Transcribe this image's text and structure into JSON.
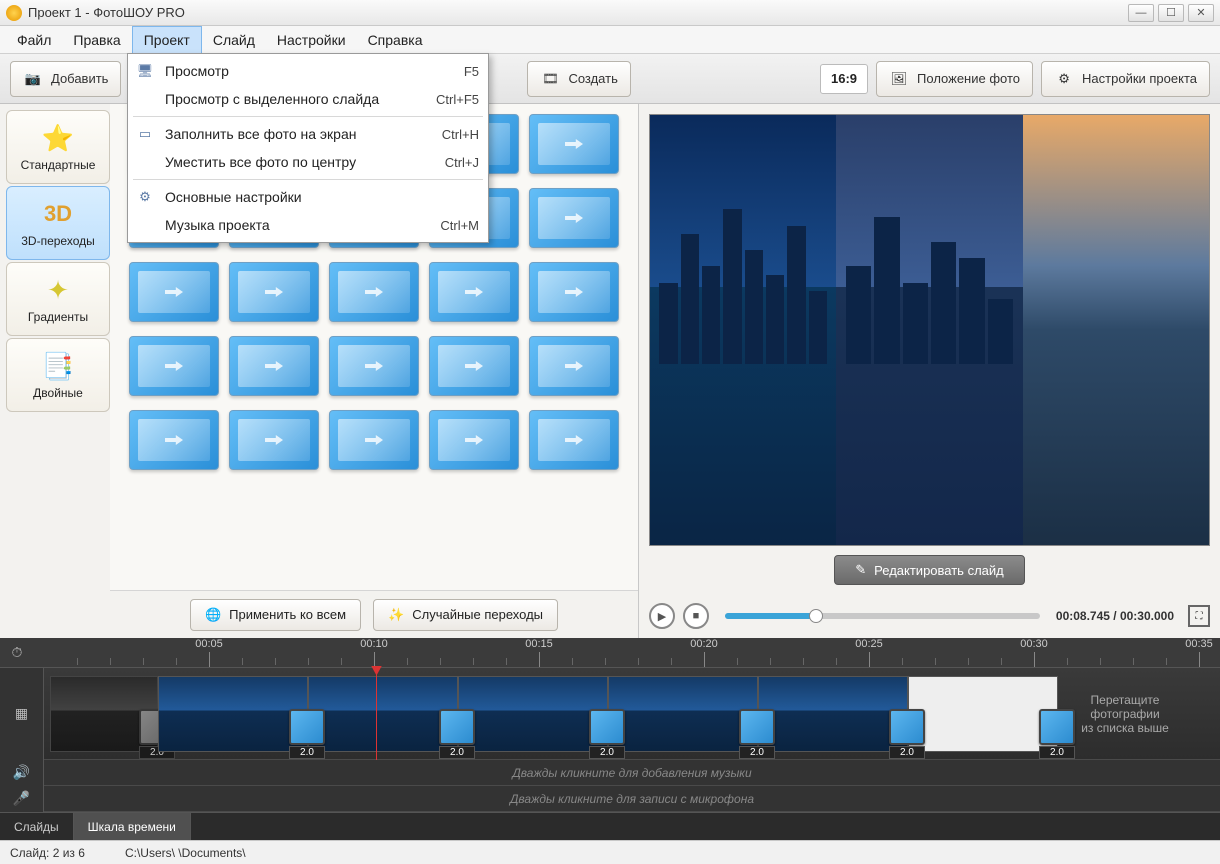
{
  "title": "Проект 1 - ФотоШОУ PRO",
  "menubar": [
    "Файл",
    "Правка",
    "Проект",
    "Слайд",
    "Настройки",
    "Справка"
  ],
  "menubar_active": 2,
  "dropdown": {
    "groups": [
      [
        {
          "icon": "monitor",
          "label": "Просмотр",
          "shortcut": "F5"
        },
        {
          "icon": "",
          "label": "Просмотр с выделенного слайда",
          "shortcut": "Ctrl+F5"
        }
      ],
      [
        {
          "icon": "fill",
          "label": "Заполнить все фото на экран",
          "shortcut": "Ctrl+H"
        },
        {
          "icon": "",
          "label": "Уместить все фото по центру",
          "shortcut": "Ctrl+J"
        }
      ],
      [
        {
          "icon": "gear",
          "label": "Основные настройки",
          "shortcut": ""
        },
        {
          "icon": "",
          "label": "Музыка проекта",
          "shortcut": "Ctrl+M"
        }
      ]
    ]
  },
  "toolbar": {
    "add": "Добавить",
    "create": "Создать",
    "ratio": "16:9",
    "pos": "Положение фото",
    "settings": "Настройки проекта"
  },
  "categories": [
    {
      "icon": "⭐",
      "label": "Стандартные"
    },
    {
      "icon": "3D",
      "label": "3D-переходы",
      "active": true
    },
    {
      "icon": "◉",
      "label": "Градиенты"
    },
    {
      "icon": "▧",
      "label": "Двойные"
    }
  ],
  "transitions_count": 25,
  "trans_buttons": {
    "apply_all": "Применить ко всем",
    "random": "Случайные переходы"
  },
  "preview": {
    "edit_label": "Редактировать слайд",
    "time": "00:08.745 / 00:30.000"
  },
  "timeline": {
    "ticks": [
      "00:05",
      "00:10",
      "00:15",
      "00:20",
      "00:25",
      "00:30",
      "00:35"
    ],
    "transition_duration": "2.0",
    "drop_hint_1": "Перетащите",
    "drop_hint_2": "фотографии",
    "drop_hint_3": "из списка выше",
    "audio_hint": "Дважды кликните для добавления музыки",
    "mic_hint": "Дважды кликните для записи с микрофона"
  },
  "bottom_tabs": [
    "Слайды",
    "Шкала времени"
  ],
  "bottom_tab_active": 1,
  "status": {
    "slide": "Слайд: 2 из 6",
    "path": "C:\\Users\\        \\Documents\\"
  }
}
